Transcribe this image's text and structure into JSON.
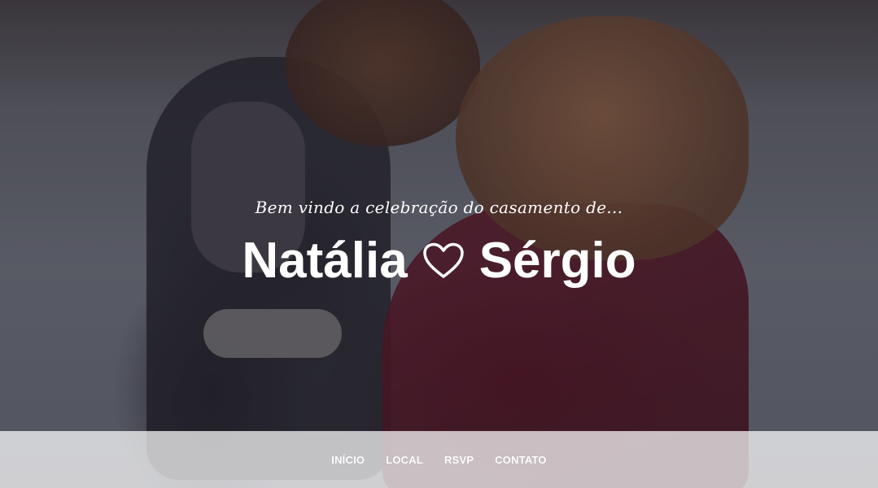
{
  "hero": {
    "tagline": "Bem vindo a celebração do casamento de...",
    "name_left": "Natália",
    "name_right": "Sérgio",
    "heart_icon": "heart-outline-icon",
    "text_color": "#ffffff"
  },
  "nav": {
    "items": [
      {
        "label": "INÍCIO"
      },
      {
        "label": "LOCAL"
      },
      {
        "label": "RSVP"
      },
      {
        "label": "CONTATO"
      }
    ]
  }
}
